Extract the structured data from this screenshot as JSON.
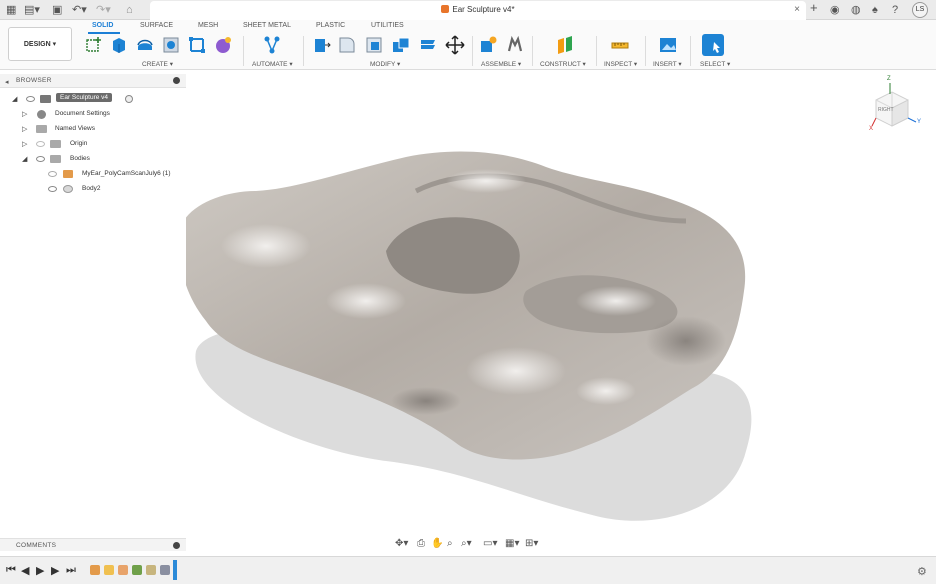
{
  "window": {
    "document_title": "Ear Sculpture v4*"
  },
  "user": {
    "initials": "LS"
  },
  "ribbon": {
    "workspace": "DESIGN ▾",
    "tabs": [
      "SOLID",
      "SURFACE",
      "MESH",
      "SHEET METAL",
      "PLASTIC",
      "UTILITIES"
    ],
    "active_tab": "SOLID",
    "groups": [
      "CREATE ▾",
      "AUTOMATE ▾",
      "MODIFY ▾",
      "ASSEMBLE ▾",
      "CONSTRUCT ▾",
      "INSPECT ▾",
      "INSERT ▾",
      "SELECT ▾"
    ]
  },
  "browser": {
    "title": "BROWSER",
    "root": "Ear Sculpture v4",
    "items": [
      "Document Settings",
      "Named Views",
      "Origin",
      "Bodies",
      "MyEar_PolyCamScanJuly6 (1)",
      "Body2"
    ]
  },
  "comments": {
    "title": "COMMENTS"
  },
  "viewcube": {
    "face": "RIGHT",
    "axis_x": "X",
    "axis_y": "Y",
    "axis_z": "Z"
  },
  "colors": {
    "accent": "#1c7fd6",
    "model": "#b7b0a9",
    "shadow": "#dcdcdc"
  }
}
